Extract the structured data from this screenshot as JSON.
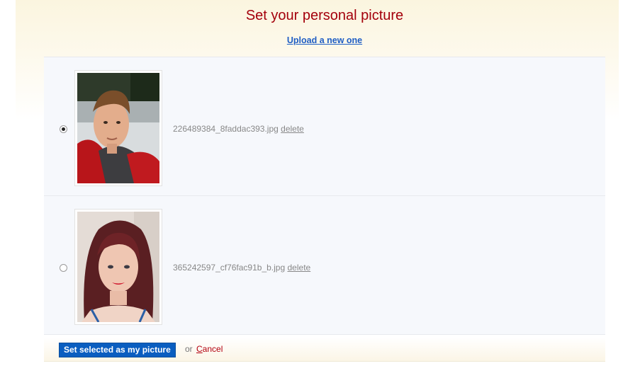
{
  "header": {
    "title": "Set your personal picture",
    "upload_link": "Upload a new one"
  },
  "pictures": [
    {
      "filename": "226489384_8faddac393.jpg",
      "delete_label": "delete",
      "selected": true
    },
    {
      "filename": "365242597_cf76fac91b_b.jpg",
      "delete_label": "delete",
      "selected": false
    }
  ],
  "footer": {
    "submit_label": "Set selected as my picture",
    "or_label": "or",
    "cancel_first": "C",
    "cancel_rest": "ancel"
  },
  "colors": {
    "title": "#a4000c",
    "link": "#1f5ec4",
    "button": "#0a5ec0",
    "cancel": "#b3000f"
  }
}
